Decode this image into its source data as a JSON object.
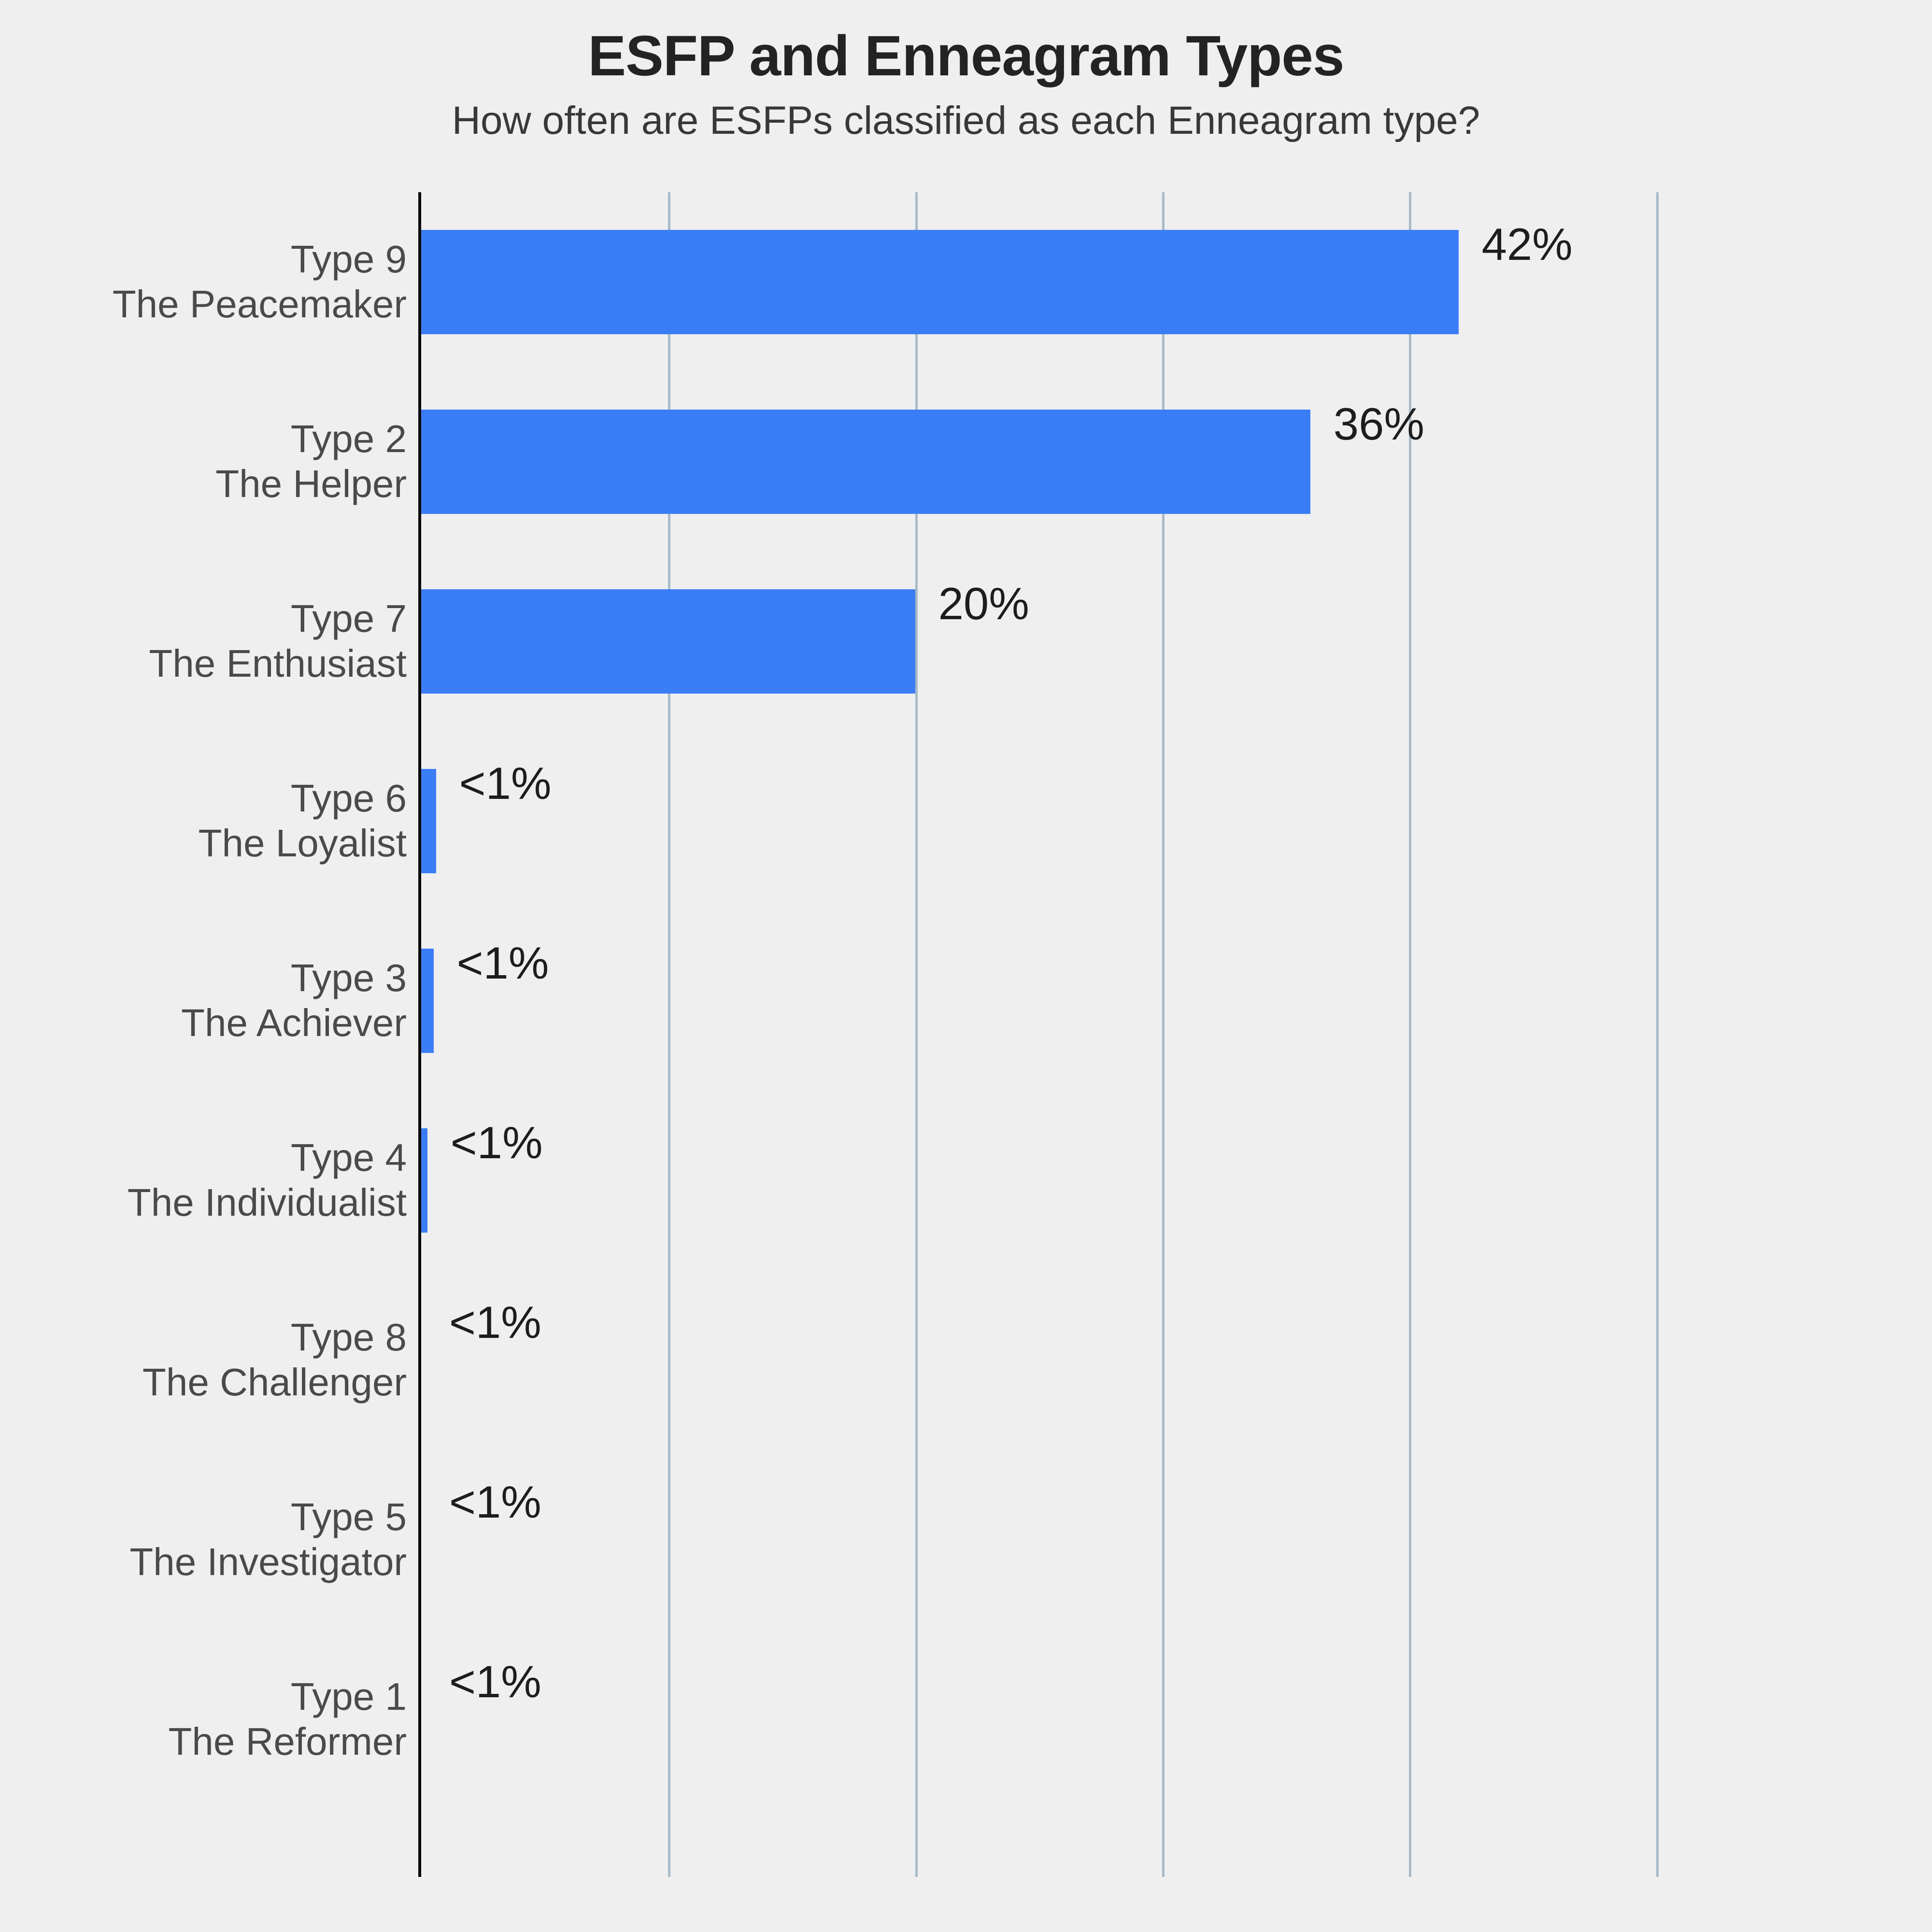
{
  "chart_data": {
    "type": "bar",
    "orientation": "horizontal",
    "title": "ESFP and Enneagram Types",
    "subtitle": "How often are ESFPs classified as each Enneagram type?",
    "xlabel": "",
    "ylabel": "",
    "xlim": [
      0,
      60
    ],
    "grid": "vertical",
    "gridline_values": [
      10,
      20,
      30,
      40,
      50
    ],
    "legend": null,
    "bar_color": "#3b7df6",
    "background_color": "#efeff0",
    "axis_color": "#0a0a0a",
    "grid_color": "#a9bac6",
    "label_color": "#4a4a4a",
    "value_color": "#1d1d1d",
    "categories": [
      "Type 9\nThe Peacemaker",
      "Type 2\nThe Helper",
      "Type 7\nThe Enthusiast",
      "Type 6\nThe Loyalist",
      "Type 3\nThe Achiever",
      "Type 4\nThe Individualist",
      "Type 8\nThe Challenger",
      "Type 5\nThe Investigator",
      "Type 1\nThe Reformer"
    ],
    "values": [
      42,
      36,
      20,
      0.6,
      0.5,
      0.25,
      0,
      0,
      0
    ],
    "value_labels": [
      "42%",
      "36%",
      "20%",
      "<1%",
      "<1%",
      "<1%",
      "<1%",
      "<1%",
      "<1%"
    ],
    "rows": [
      {
        "type": "Type 9",
        "name": "The Peacemaker",
        "value": 42,
        "label": "42%"
      },
      {
        "type": "Type 2",
        "name": "The Helper",
        "value": 36,
        "label": "36%"
      },
      {
        "type": "Type 7",
        "name": "The Enthusiast",
        "value": 20,
        "label": "20%"
      },
      {
        "type": "Type 6",
        "name": "The Loyalist",
        "value": 0.6,
        "label": "<1%"
      },
      {
        "type": "Type 3",
        "name": "The Achiever",
        "value": 0.5,
        "label": "<1%"
      },
      {
        "type": "Type 4",
        "name": "The Individualist",
        "value": 0.25,
        "label": "<1%"
      },
      {
        "type": "Type 8",
        "name": "The Challenger",
        "value": 0,
        "label": "<1%"
      },
      {
        "type": "Type 5",
        "name": "The Investigator",
        "value": 0,
        "label": "<1%"
      },
      {
        "type": "Type 1",
        "name": "The Reformer",
        "value": 0,
        "label": "<1%"
      }
    ]
  }
}
